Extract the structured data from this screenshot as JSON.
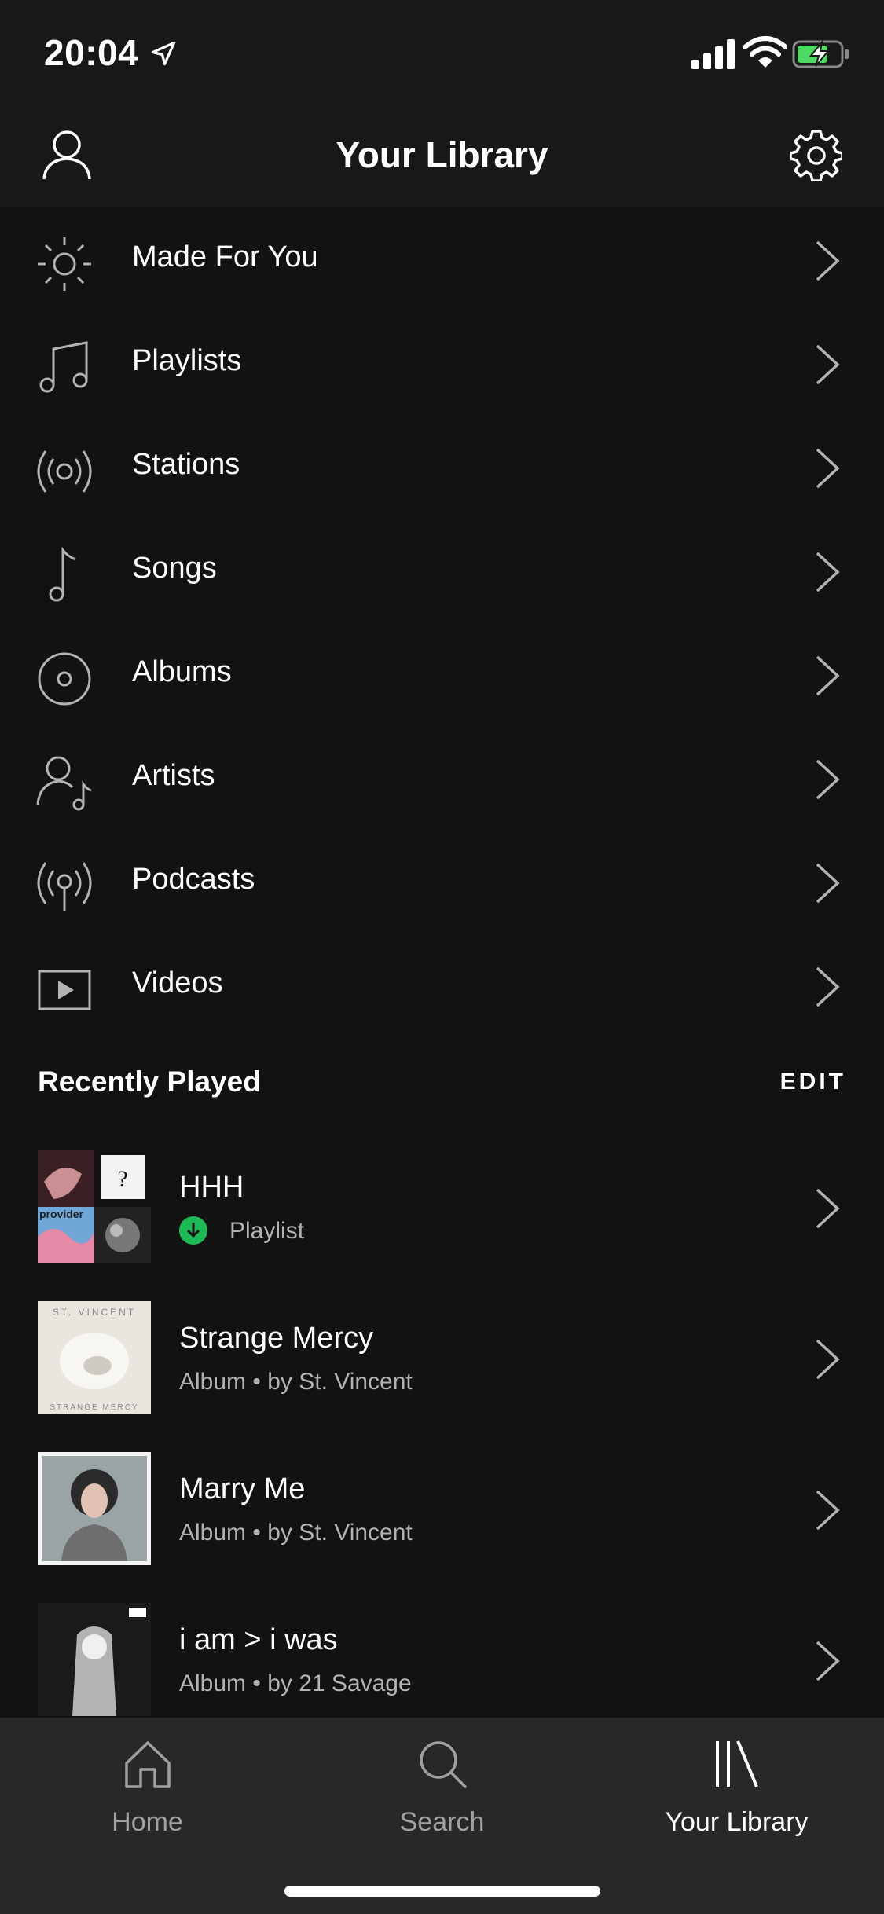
{
  "status_bar": {
    "time": "20:04"
  },
  "header": {
    "title": "Your Library"
  },
  "menu": {
    "items": [
      {
        "label": "Made For You",
        "icon": "sun-icon"
      },
      {
        "label": "Playlists",
        "icon": "music-notes-icon"
      },
      {
        "label": "Stations",
        "icon": "radio-icon"
      },
      {
        "label": "Songs",
        "icon": "music-note-icon"
      },
      {
        "label": "Albums",
        "icon": "disc-icon"
      },
      {
        "label": "Artists",
        "icon": "artist-icon"
      },
      {
        "label": "Podcasts",
        "icon": "podcast-icon"
      },
      {
        "label": "Videos",
        "icon": "video-icon"
      }
    ]
  },
  "recently_played": {
    "title": "Recently Played",
    "edit_label": "EDIT",
    "items": [
      {
        "title": "HHH",
        "subtitle": "Playlist",
        "downloaded": true
      },
      {
        "title": "Strange Mercy",
        "subtitle": "Album • by St. Vincent",
        "cover_text": "ST. VINCENT",
        "cover_text_bottom": "STRANGE MERCY"
      },
      {
        "title": "Marry Me",
        "subtitle": "Album • by St. Vincent"
      },
      {
        "title": "i am > i was",
        "subtitle": "Album • by 21 Savage"
      }
    ]
  },
  "tabs": [
    {
      "label": "Home",
      "icon": "home-icon",
      "active": false
    },
    {
      "label": "Search",
      "icon": "search-icon",
      "active": false
    },
    {
      "label": "Your Library",
      "icon": "library-icon",
      "active": true
    }
  ],
  "colors": {
    "accent": "#1db954",
    "background": "#121212",
    "tab_bar": "#282828"
  }
}
